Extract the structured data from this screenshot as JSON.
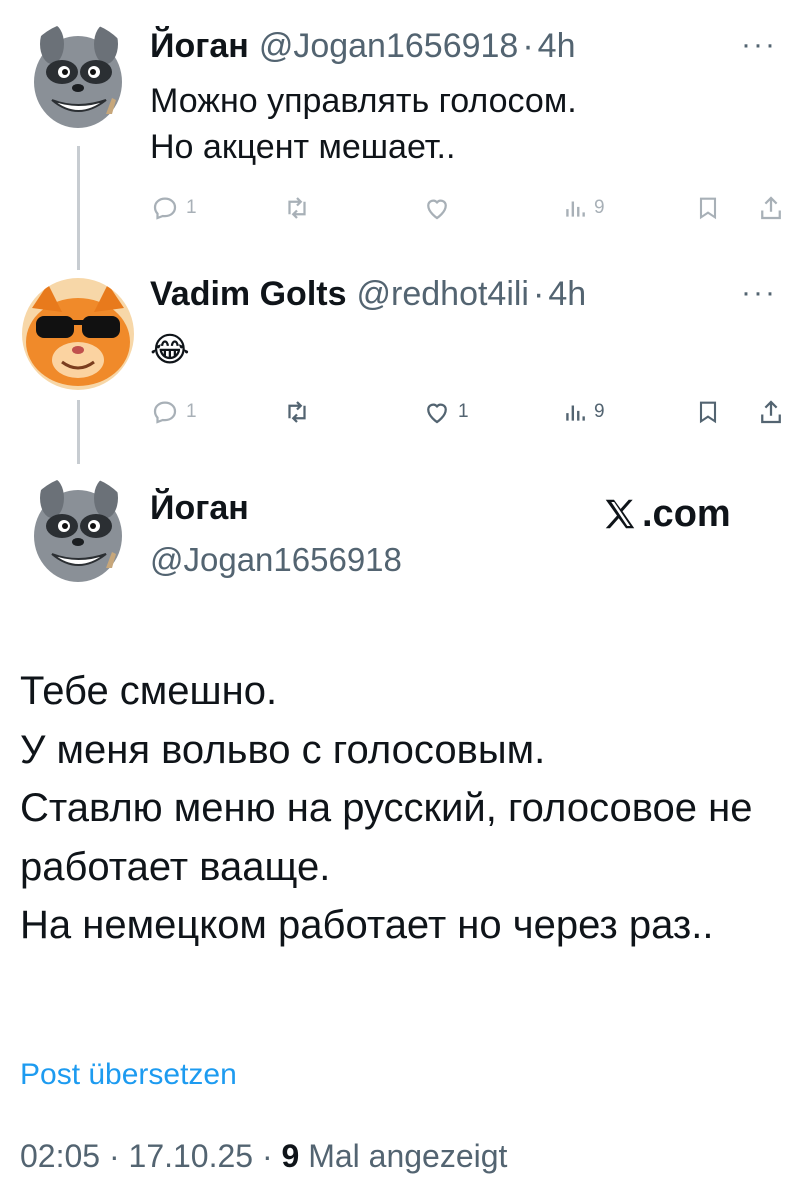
{
  "thread": [
    {
      "name": "Йоган",
      "handle": "@Jogan1656918",
      "dot": "·",
      "time": "4h",
      "more": "···",
      "lines": [
        "Можно управлять голосом.",
        "Но акцент мешает.."
      ],
      "highlighted_line": 1,
      "replies": "1",
      "reposts": "",
      "likes": "",
      "views": "9",
      "avatar": "raccoon-avatar"
    },
    {
      "name": "Vadim Golts",
      "handle": "@redhot4ili",
      "dot": "·",
      "time": "4h",
      "more": "···",
      "text": "😂",
      "replies": "1",
      "reposts": "",
      "likes": "1",
      "views": "9",
      "avatar": "cat-sunglasses-avatar"
    }
  ],
  "main": {
    "name": "Йоган",
    "handle": "@Jogan1656918",
    "brand": ".com",
    "body": "Тебе смешно.\nУ меня вольво с голосовым.\nСтавлю меню на русский, голосовое не работает вааще.\nНа немецком работает но через раз..",
    "translate_link": "Post übersetzen",
    "time": "02:05",
    "date": "17.10.25",
    "sep": "·",
    "views_count": "9",
    "views_label": "Mal angezeigt"
  },
  "colors": {
    "text": "#0f1419",
    "muted": "#536471",
    "link": "#1d9bf0",
    "highlight": "#eaf39a",
    "thread_line": "#c7ccd1"
  },
  "icons": [
    "reply-icon",
    "repost-icon",
    "like-icon",
    "views-icon",
    "bookmark-icon",
    "share-icon",
    "x-logo-icon"
  ]
}
